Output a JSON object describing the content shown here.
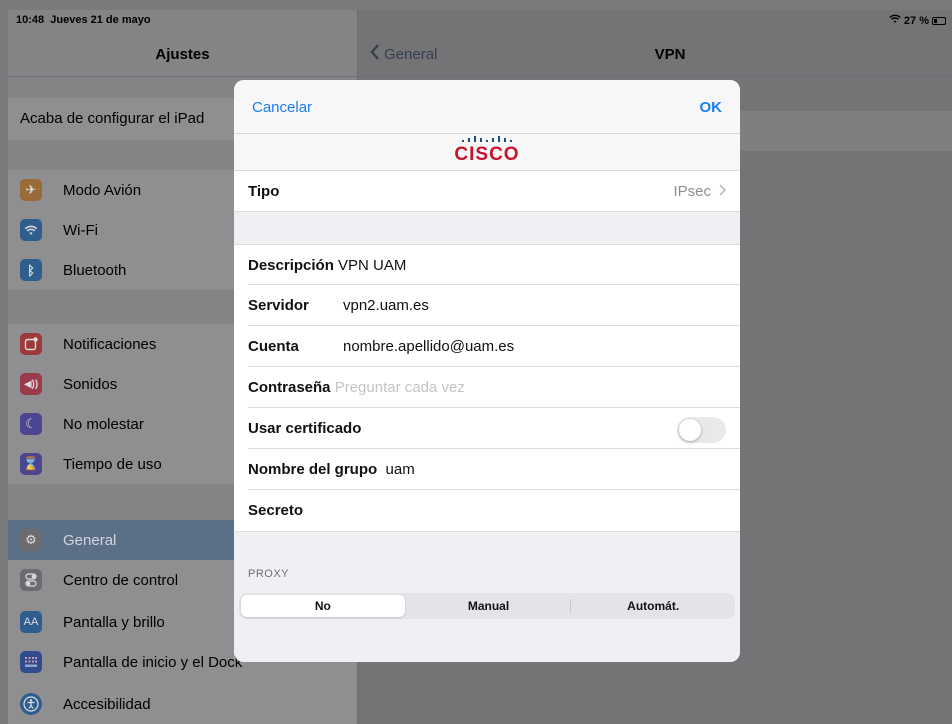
{
  "status": {
    "time": "10:48",
    "date": "Jueves 21 de mayo",
    "battery": "27 %",
    "battery_level": 0.27
  },
  "sidebar": {
    "title": "Ajustes",
    "setup_label": "Acaba de configurar el iPad",
    "items": [
      {
        "label": "Modo Avión",
        "icon": "airplane-icon",
        "color": "#9a6a38"
      },
      {
        "label": "Wi-Fi",
        "icon": "wifi-icon",
        "color": "#2f5d8e"
      },
      {
        "label": "Bluetooth",
        "icon": "bluetooth-icon",
        "color": "#2f5d8e"
      },
      {
        "label": "Notificaciones",
        "icon": "notifications-icon",
        "color": "#9b3a38"
      },
      {
        "label": "Sonidos",
        "icon": "sounds-icon",
        "color": "#9b3a4a"
      },
      {
        "label": "No molestar",
        "icon": "moon-icon",
        "color": "#4b4690"
      },
      {
        "label": "Tiempo de uso",
        "icon": "hourglass-icon",
        "color": "#4b4690"
      },
      {
        "label": "General",
        "icon": "gear-icon",
        "color": "#6c6c70"
      },
      {
        "label": "Centro de control",
        "icon": "control-center-icon",
        "color": "#6c6c70"
      },
      {
        "label": "Pantalla y brillo",
        "icon": "display-icon",
        "color": "#2f5d8e"
      },
      {
        "label": "Pantalla de inicio y el Dock",
        "icon": "home-screen-icon",
        "color": "#2f4c8e"
      },
      {
        "label": "Accesibilidad",
        "icon": "accessibility-icon",
        "color": "#2f5d8e"
      }
    ],
    "selected": "General"
  },
  "detail": {
    "back_label": "General",
    "title": "VPN"
  },
  "modal": {
    "cancel": "Cancelar",
    "ok": "OK",
    "logo_text": "CISCO",
    "tipo_label": "Tipo",
    "tipo_value": "IPsec",
    "descripcion_label": "Descripción",
    "descripcion_value": "VPN UAM",
    "servidor_label": "Servidor",
    "servidor_value": "vpn2.uam.es",
    "cuenta_label": "Cuenta",
    "cuenta_value": "nombre.apellido@uam.es",
    "contrasena_label": "Contraseña",
    "contrasena_placeholder": "Preguntar cada vez",
    "certificado_label": "Usar certificado",
    "certificado_on": false,
    "grupo_label": "Nombre del grupo",
    "grupo_value": "uam",
    "secreto_label": "Secreto",
    "proxy_header": "PROXY",
    "proxy_options": [
      "No",
      "Manual",
      "Automát."
    ],
    "proxy_selected": "No"
  }
}
